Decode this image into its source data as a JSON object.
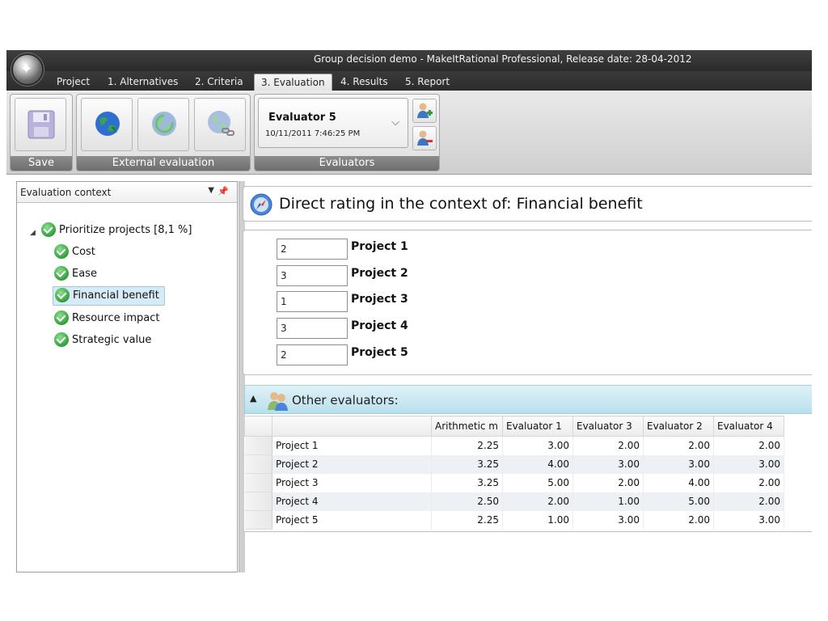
{
  "window": {
    "title": "Group decision demo - MakeItRational Professional, Release date: 28-04-2012"
  },
  "tabs": [
    {
      "label": "Project",
      "active": false
    },
    {
      "label": "1. Alternatives",
      "active": false
    },
    {
      "label": "2. Criteria",
      "active": false
    },
    {
      "label": "3. Evaluation",
      "active": true
    },
    {
      "label": "4. Results",
      "active": false
    },
    {
      "label": "5. Report",
      "active": false
    }
  ],
  "ribbon": {
    "save_group_label": "Save",
    "external_group_label": "External evaluation",
    "evaluators_group_label": "Evaluators",
    "evaluator": {
      "name": "Evaluator 5",
      "date": "10/11/2011 7:46:25 PM"
    },
    "icons": [
      "floppy-disk-icon",
      "globe-send-icon",
      "globe-receive-icon",
      "globe-link-icon",
      "add-user-icon",
      "remove-user-icon"
    ]
  },
  "context_panel": {
    "title": "Evaluation context",
    "root": {
      "label": "Prioritize projects [8,1 %]"
    },
    "children": [
      {
        "label": "Cost",
        "selected": false
      },
      {
        "label": "Ease",
        "selected": false
      },
      {
        "label": "Financial benefit",
        "selected": true
      },
      {
        "label": "Resource impact",
        "selected": false
      },
      {
        "label": "Strategic value",
        "selected": false
      }
    ]
  },
  "rating": {
    "header": "Direct rating in the context of: Financial benefit",
    "rows": [
      {
        "value": "2",
        "label": "Project 1"
      },
      {
        "value": "3",
        "label": "Project 2"
      },
      {
        "value": "1",
        "label": "Project 3"
      },
      {
        "value": "3",
        "label": "Project 4"
      },
      {
        "value": "2",
        "label": "Project 5"
      }
    ]
  },
  "other_evaluators": {
    "title": "Other evaluators:",
    "columns": [
      "Arithmetic m",
      "Evaluator 1",
      "Evaluator 3",
      "Evaluator 2",
      "Evaluator 4"
    ],
    "rows": [
      {
        "name": "Project 1",
        "values": [
          "2.25",
          "3.00",
          "2.00",
          "2.00",
          "2.00"
        ]
      },
      {
        "name": "Project 2",
        "values": [
          "3.25",
          "4.00",
          "3.00",
          "3.00",
          "3.00"
        ]
      },
      {
        "name": "Project 3",
        "values": [
          "3.25",
          "5.00",
          "2.00",
          "4.00",
          "2.00"
        ]
      },
      {
        "name": "Project 4",
        "values": [
          "2.50",
          "2.00",
          "1.00",
          "5.00",
          "2.00"
        ]
      },
      {
        "name": "Project 5",
        "values": [
          "2.25",
          "1.00",
          "3.00",
          "2.00",
          "3.00"
        ]
      }
    ]
  },
  "colors": {
    "accent": "#b9e0ed",
    "selection": "#d7ebf6",
    "check_green": "#2f9e3a"
  }
}
